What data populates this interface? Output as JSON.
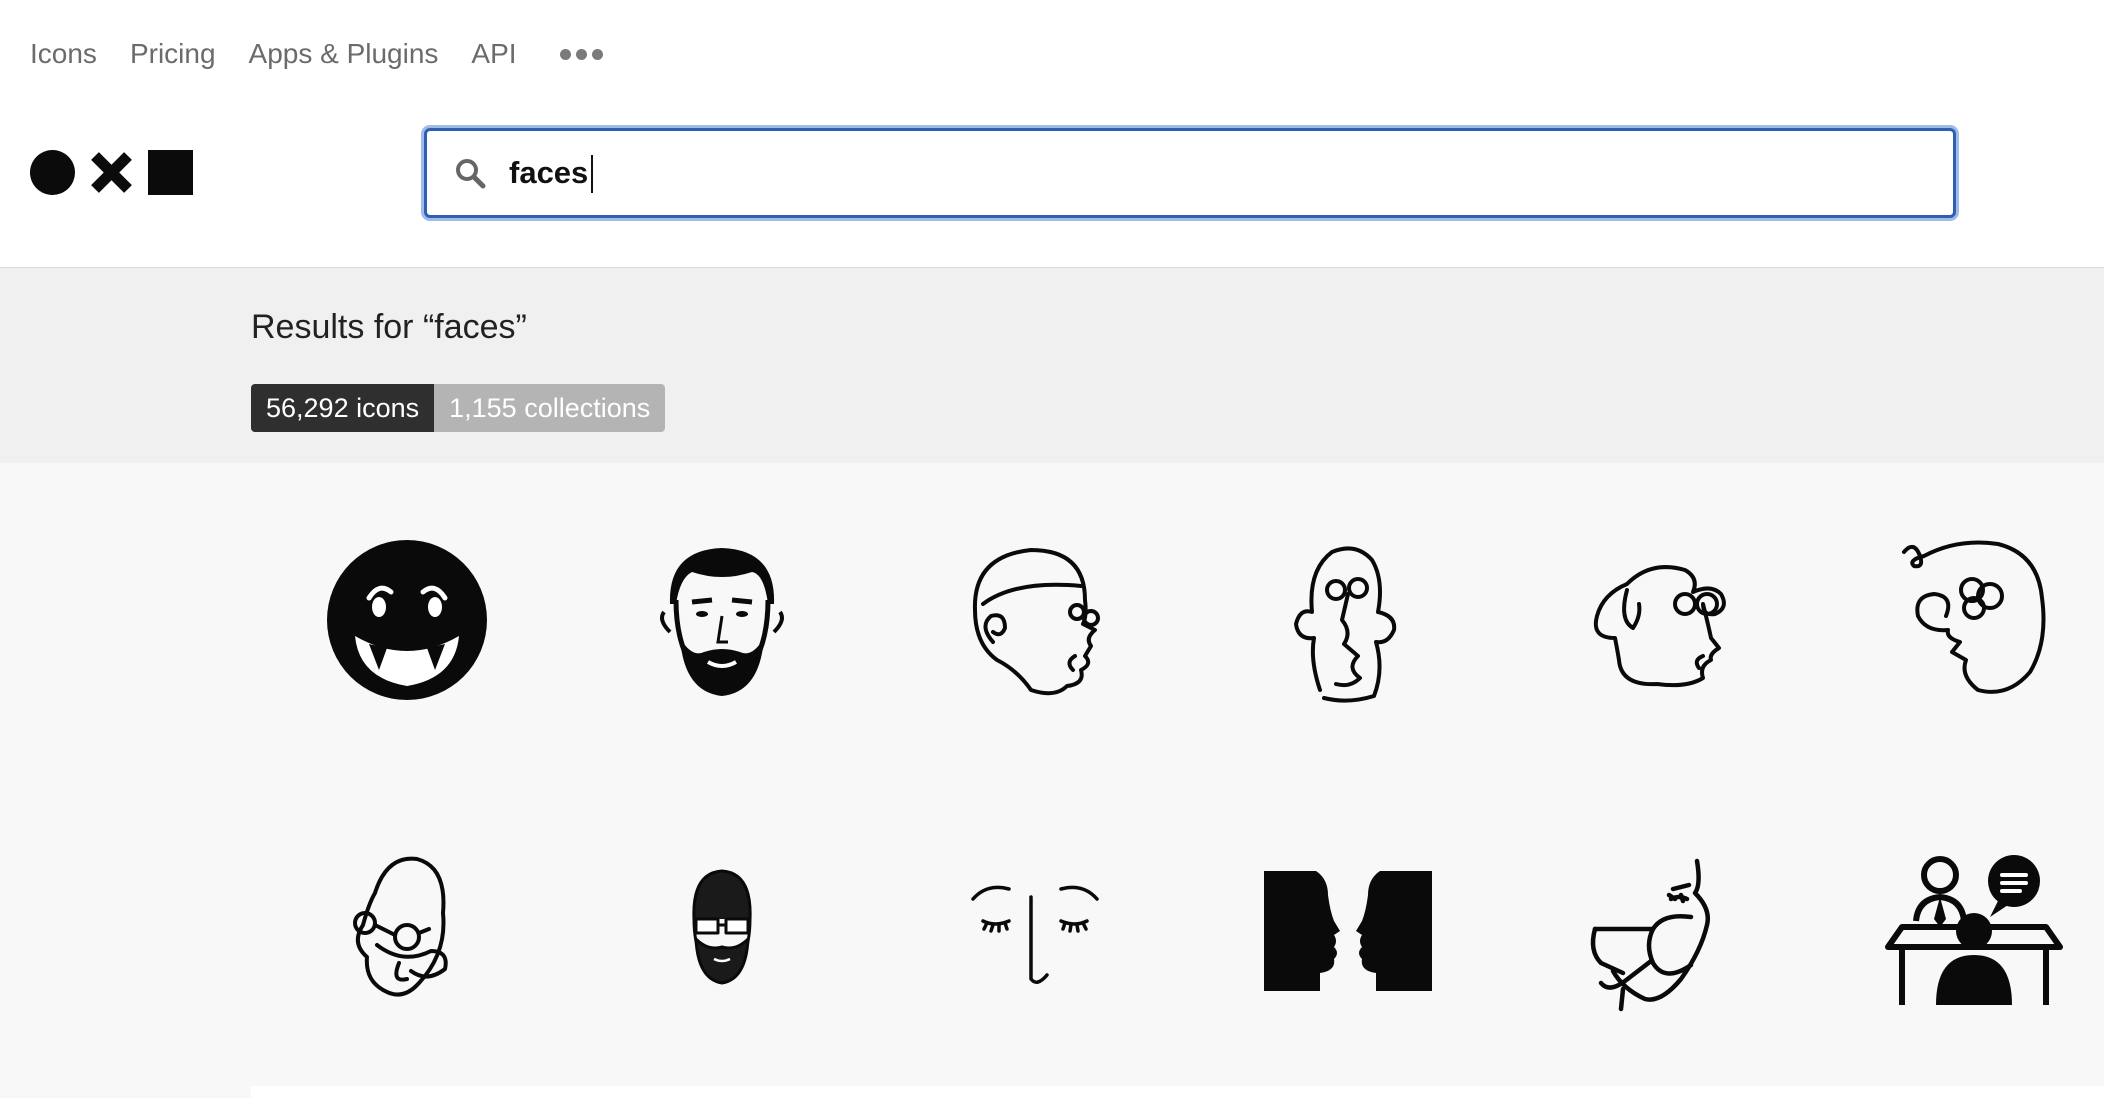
{
  "nav": {
    "items": [
      "Icons",
      "Pricing",
      "Apps & Plugins",
      "API"
    ],
    "more_icon": "more-dots-icon"
  },
  "logo": {
    "icons": [
      "circle-icon",
      "x-icon",
      "square-icon"
    ]
  },
  "search": {
    "value": "faces",
    "icon": "search-icon"
  },
  "results": {
    "title": "Results for “faces”",
    "tabs": [
      {
        "label": "56,292 icons",
        "active": true
      },
      {
        "label": "1,155 collections",
        "active": false
      }
    ]
  },
  "icons": [
    "vampire-smiley-face-icon",
    "bearded-man-face-icon",
    "line-art-face-icon",
    "line-art-long-face-icon",
    "line-art-profile-face-icon",
    "line-art-swirl-face-icon",
    "line-art-glasses-face-icon",
    "hipster-glasses-face-icon",
    "closed-eyes-face-icon",
    "two-profiles-facing-icon",
    "masked-face-profile-icon",
    "interview-meeting-icon"
  ],
  "colors": {
    "accent": "#2f5fb3",
    "focus_ring": "#9fbce8",
    "active_tab": "#2f2f2f",
    "inactive_tab": "#b4b4b4"
  }
}
